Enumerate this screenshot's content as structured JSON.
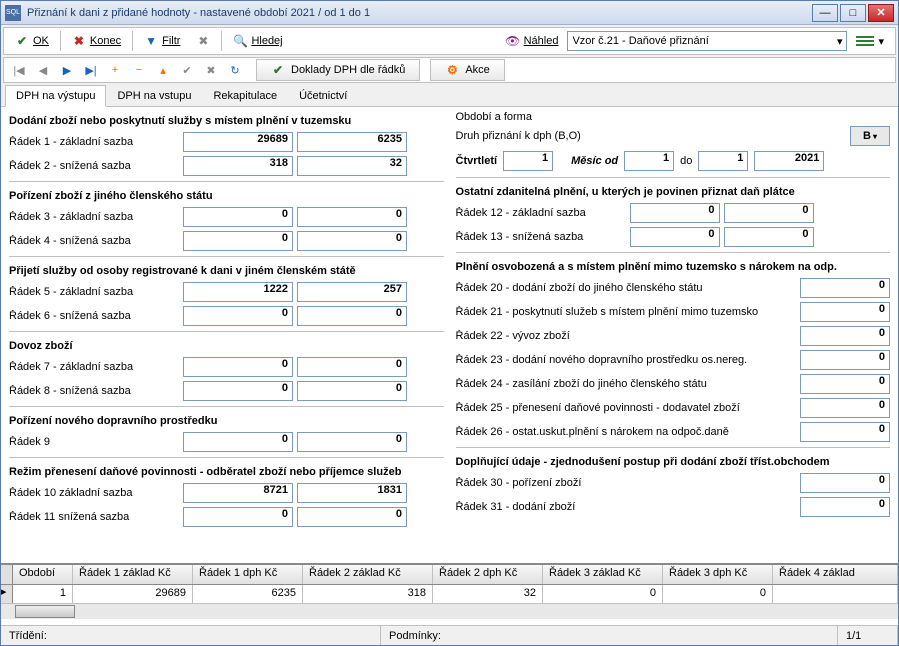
{
  "title": "Přiznání k dani z přidané hodnoty - nastavené období 2021 / od 1 do 1",
  "toolbar": {
    "ok": "OK",
    "konec": "Konec",
    "filtr": "Filtr",
    "hledej": "Hledej",
    "nahled": "Náhled",
    "select_value": "Vzor č.21 - Daňové přiznání",
    "doklady": "Doklady DPH dle řádků",
    "akce": "Akce"
  },
  "tabs": {
    "t1": "DPH na výstupu",
    "t2": "DPH na vstupu",
    "t3": "Rekapitulace",
    "t4": "Účetnictví"
  },
  "left": {
    "sec1": "Dodání zboží nebo poskytnutí služby s místem plnění v tuzemsku",
    "r1_label": "Řádek 1 - základní sazba",
    "r1_a": "29689",
    "r1_b": "6235",
    "r2_label": "Řádek 2 - snížená sazba",
    "r2_a": "318",
    "r2_b": "32",
    "sec2": "Pořízení zboží z jiného členského státu",
    "r3_label": "Řádek 3 - základní sazba",
    "r3_a": "0",
    "r3_b": "0",
    "r4_label": "Řádek 4 - snížená sazba",
    "r4_a": "0",
    "r4_b": "0",
    "sec3": "Přijetí služby od osoby registrované k dani v jiném členském státě",
    "r5_label": "Řádek 5 - základní sazba",
    "r5_a": "1222",
    "r5_b": "257",
    "r6_label": "Řádek 6 - snížená sazba",
    "r6_a": "0",
    "r6_b": "0",
    "sec4": "Dovoz zboží",
    "r7_label": "Řádek 7 - základní sazba",
    "r7_a": "0",
    "r7_b": "0",
    "r8_label": "Řádek 8 - snížená sazba",
    "r8_a": "0",
    "r8_b": "0",
    "sec5": "Pořízení nového dopravního prostředku",
    "r9_label": "Řádek 9",
    "r9_a": "0",
    "r9_b": "0",
    "sec6": "Režim přenesení daňové povinnosti - odběratel zboží nebo příjemce služeb",
    "r10_label": "Řádek 10 základní sazba",
    "r10_a": "8721",
    "r10_b": "1831",
    "r11_label": "Řádek 11 snížená sazba",
    "r11_a": "0",
    "r11_b": "0"
  },
  "right": {
    "sec_period": "Období a forma",
    "druh_label": "Druh přiznání k dph (B,O)",
    "druh_val": "B",
    "ctvrtleti_label": "Čtvrtletí",
    "ctvrtleti_val": "1",
    "mesic_label": "Měsíc od",
    "mesic_od": "1",
    "do_label": "do",
    "mesic_do": "1",
    "rok": "2021",
    "sec_ostatni": "Ostatní zdanitelná plnění, u kterých je povinen přiznat daň plátce",
    "r12_label": "Řádek 12 - základní sazba",
    "r12_a": "0",
    "r12_b": "0",
    "r13_label": "Řádek 13 - snížená sazba",
    "r13_a": "0",
    "r13_b": "0",
    "sec_osvob": "Plnění osvobozená a s místem plnění mimo tuzemsko s nárokem na odp.",
    "r20_label": "Řádek 20 - dodání zboží do jiného členského státu",
    "r20": "0",
    "r21_label": "Řádek 21 - poskytnutí služeb s místem plnění mimo tuzemsko",
    "r21": "0",
    "r22_label": "Řádek 22 - vývoz zboží",
    "r22": "0",
    "r23_label": "Řádek 23 - dodání nového dopravního prostředku os.nereg.",
    "r23": "0",
    "r24_label": "Řádek 24 - zasílání zboží do jiného členského státu",
    "r24": "0",
    "r25_label": "Řádek 25 - přenesení daňové povinnosti - dodavatel zboží",
    "r25": "0",
    "r26_label": "Řádek 26 - ostat.uskut.plnění s nárokem na odpoč.daně",
    "r26": "0",
    "sec_dopl": "Doplňující údaje - zjednodušení postup při dodání zboží tříst.obchodem",
    "r30_label": "Řádek 30 - pořízení zboží",
    "r30": "0",
    "r31_label": "Řádek 31 - dodání zboží",
    "r31": "0"
  },
  "grid": {
    "h0": "Období",
    "h1": "Řádek 1 základ Kč",
    "h2": "Řádek 1 dph Kč",
    "h3": "Řádek 2  základ Kč",
    "h4": "Řádek 2 dph Kč",
    "h5": "Řádek 3 základ Kč",
    "h6": "Řádek 3 dph Kč",
    "h7": "Řádek 4 základ",
    "c0": "1",
    "c1": "29689",
    "c2": "6235",
    "c3": "318",
    "c4": "32",
    "c5": "0",
    "c6": "0"
  },
  "status": {
    "trideni": "Třídění:",
    "podminky": "Podmínky:",
    "count": "1/1"
  }
}
